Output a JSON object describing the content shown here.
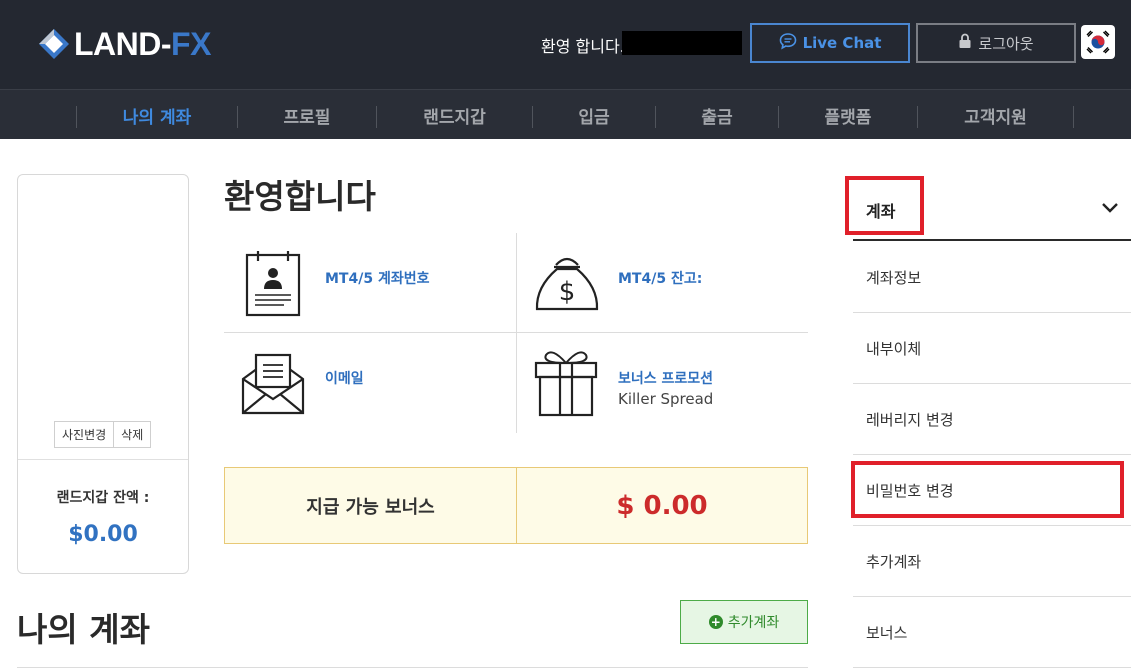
{
  "header": {
    "logo": {
      "text_main": "LAND-",
      "text_accent": "FX"
    },
    "welcome": "환영 합니다.",
    "live_chat_label": "Live Chat",
    "logout_label": "로그아웃",
    "language_icon": "korea-flag-icon"
  },
  "nav": {
    "items": [
      {
        "label": "나의 계좌",
        "active": true
      },
      {
        "label": "프로필",
        "active": false
      },
      {
        "label": "랜드지갑",
        "active": false
      },
      {
        "label": "입금",
        "active": false
      },
      {
        "label": "출금",
        "active": false
      },
      {
        "label": "플랫폼",
        "active": false
      },
      {
        "label": "고객지원",
        "active": false
      }
    ]
  },
  "profile": {
    "change_photo_label": "사진변경",
    "delete_label": "삭제",
    "wallet_balance_label": "랜드지갑 잔액 :",
    "wallet_balance_value": "$0.00"
  },
  "main": {
    "title": "환영합니다",
    "info": {
      "account_number_label": "MT4/5 계좌번호",
      "balance_label": "MT4/5 잔고:",
      "email_label": "이메일",
      "bonus_promo_label": "보너스 프로모션",
      "bonus_promo_value": "Killer Spread"
    },
    "bonus": {
      "label": "지급 가능 보너스",
      "value": "$ 0.00"
    },
    "my_accounts_title": "나의 계좌",
    "add_account_label": "추가계좌"
  },
  "side_menu": {
    "header_label": "계좌",
    "items": [
      {
        "label": "계좌정보"
      },
      {
        "label": "내부이체"
      },
      {
        "label": "레버리지 변경"
      },
      {
        "label": "비밀번호 변경"
      },
      {
        "label": "추가계좌"
      },
      {
        "label": "보너스"
      }
    ]
  },
  "colors": {
    "header_bg": "#242831",
    "nav_active": "#3f8ae0",
    "accent_blue": "#2f6fbe",
    "bonus_red": "#cc2b2b",
    "highlight_red": "#e0202a",
    "add_green": "#2f8a2b"
  }
}
